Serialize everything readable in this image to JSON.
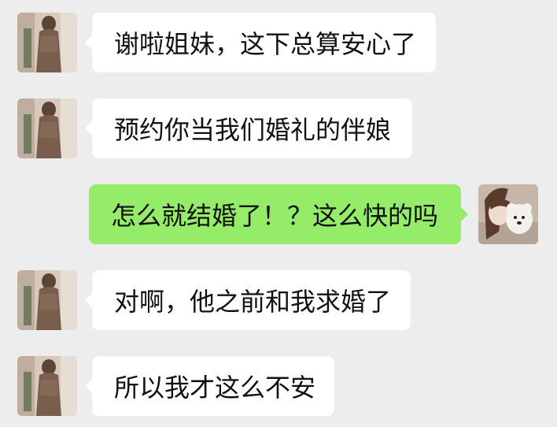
{
  "messages": [
    {
      "side": "left",
      "text": "谢啦姐妹，这下总算安心了",
      "avatar": "contact-avatar"
    },
    {
      "side": "left",
      "text": "预约你当我们婚礼的伴娘",
      "avatar": "contact-avatar"
    },
    {
      "side": "right",
      "text": "怎么就结婚了！？这么快的吗",
      "avatar": "self-avatar"
    },
    {
      "side": "left",
      "text": "对啊，他之前和我求婚了",
      "avatar": "contact-avatar"
    },
    {
      "side": "left",
      "text": "所以我才这么不安",
      "avatar": "contact-avatar"
    }
  ],
  "colors": {
    "background": "#ededed",
    "incoming_bubble": "#ffffff",
    "outgoing_bubble": "#95ec69"
  }
}
